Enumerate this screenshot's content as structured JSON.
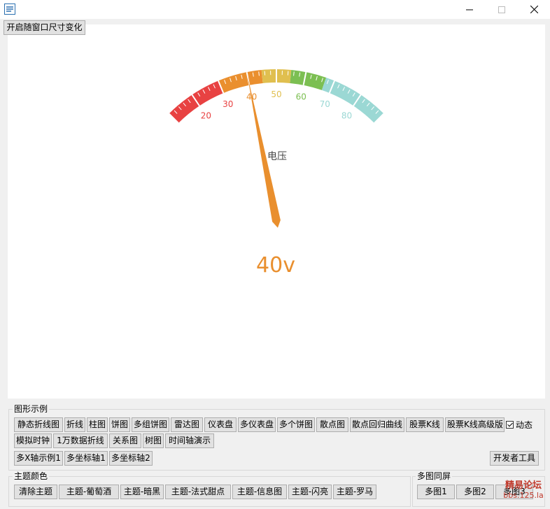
{
  "window": {
    "minimize_icon": "minimize-icon",
    "maximize_icon": "maximize-icon",
    "close_icon": "close-icon"
  },
  "toggle_resize_label": "开启随窗口尺寸变化",
  "gauge": {
    "name": "电压",
    "value": 40,
    "value_label": "40v",
    "min": 10,
    "max": 90,
    "ticks": [
      "20",
      "30",
      "40",
      "50",
      "60",
      "70",
      "80"
    ],
    "colors": {
      "red": "#e84242",
      "orange": "#ea8f2e",
      "yellow": "#e0bf4f",
      "green": "#7cbf52",
      "teal": "#9bd8d4",
      "pointer": "#e98f2e",
      "name_text": "#464646"
    }
  },
  "chart_examples": {
    "title": "图形示例",
    "buttons": [
      "静态折线图",
      "折线",
      "柱图",
      "饼图",
      "多组饼图",
      "雷达图",
      "仪表盘",
      "多仪表盘",
      "多个饼图",
      "散点图",
      "散点回归曲线",
      "股票K线",
      "股票K线高级版",
      "模拟时钟",
      "1万数据折线",
      "关系图",
      "树图",
      "时间轴演示",
      "多X轴示例1",
      "多坐标轴1",
      "多坐标轴2"
    ],
    "dynamic_checkbox": {
      "label": "动态",
      "checked": true
    },
    "dev_tools_label": "开发者工具"
  },
  "theme": {
    "title": "主题颜色",
    "buttons": [
      "清除主题",
      "主题-葡萄酒",
      "主题-暗黑",
      "主题-法式甜点",
      "主题-信息图",
      "主题-闪亮",
      "主题-罗马"
    ]
  },
  "multi": {
    "title": "多图同屏",
    "buttons": [
      "多图1",
      "多图2",
      "多图3"
    ]
  },
  "watermark": {
    "line1": "精易论坛",
    "line2": "bbs.125.la"
  }
}
